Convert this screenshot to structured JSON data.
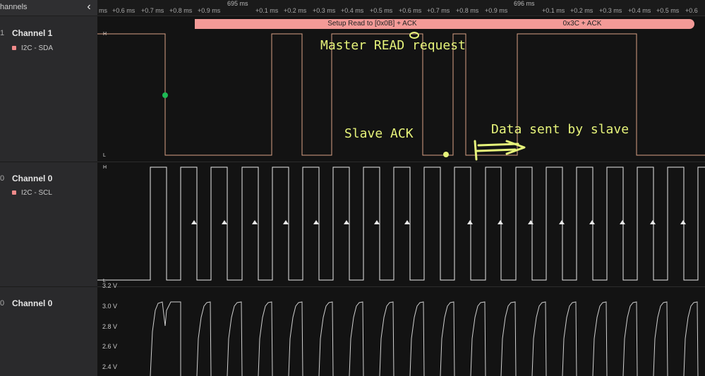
{
  "sidebar": {
    "title": "hannels",
    "collapse_icon": "chevron-left-icon",
    "channels": [
      {
        "index": "1",
        "name": "Channel 1",
        "analyzer": "I2C - SDA",
        "color": "#f08a8a"
      },
      {
        "index": "0",
        "name": "Channel 0",
        "analyzer": "I2C - SCL",
        "color": "#f08a8a"
      },
      {
        "index": "0",
        "name": "Channel 0",
        "analyzer": ""
      }
    ]
  },
  "ruler": {
    "ticks": [
      "ms",
      "+0.6 ms",
      "+0.7 ms",
      "+0.8 ms",
      "+0.9 ms",
      "+0.1 ms",
      "+0.2 ms",
      "+0.3 ms",
      "+0.4 ms",
      "+0.5 ms",
      "+0.6 ms",
      "+0.7 ms",
      "+0.8 ms",
      "+0.9 ms",
      "+0.1 ms",
      "+0.2 ms",
      "+0.3 ms",
      "+0.4 ms",
      "+0.5 ms",
      "+0.6"
    ],
    "major": [
      "695 ms",
      "696 ms"
    ]
  },
  "annotations": [
    {
      "label": "Setup Read to [0x0B] + ACK",
      "color": "#f39a97"
    },
    {
      "label": "0x3C + ACK",
      "color": "#f39a97"
    }
  ],
  "levels": {
    "high": "H",
    "low": "L"
  },
  "analog": {
    "labels": [
      "3.0 V",
      "2.8 V",
      "2.6 V",
      "2.4 V"
    ],
    "top_partial": "3.2 V"
  },
  "notes": {
    "master": "Master READ request",
    "slave_ack": "Slave ACK",
    "data": "Data sent by slave"
  },
  "colors": {
    "sda_trace": "#d9a184",
    "clock_trace": "#e8e8e8",
    "analog_trace": "#cfcfcf",
    "note": "#e6f37a",
    "marker": "#1db954"
  }
}
